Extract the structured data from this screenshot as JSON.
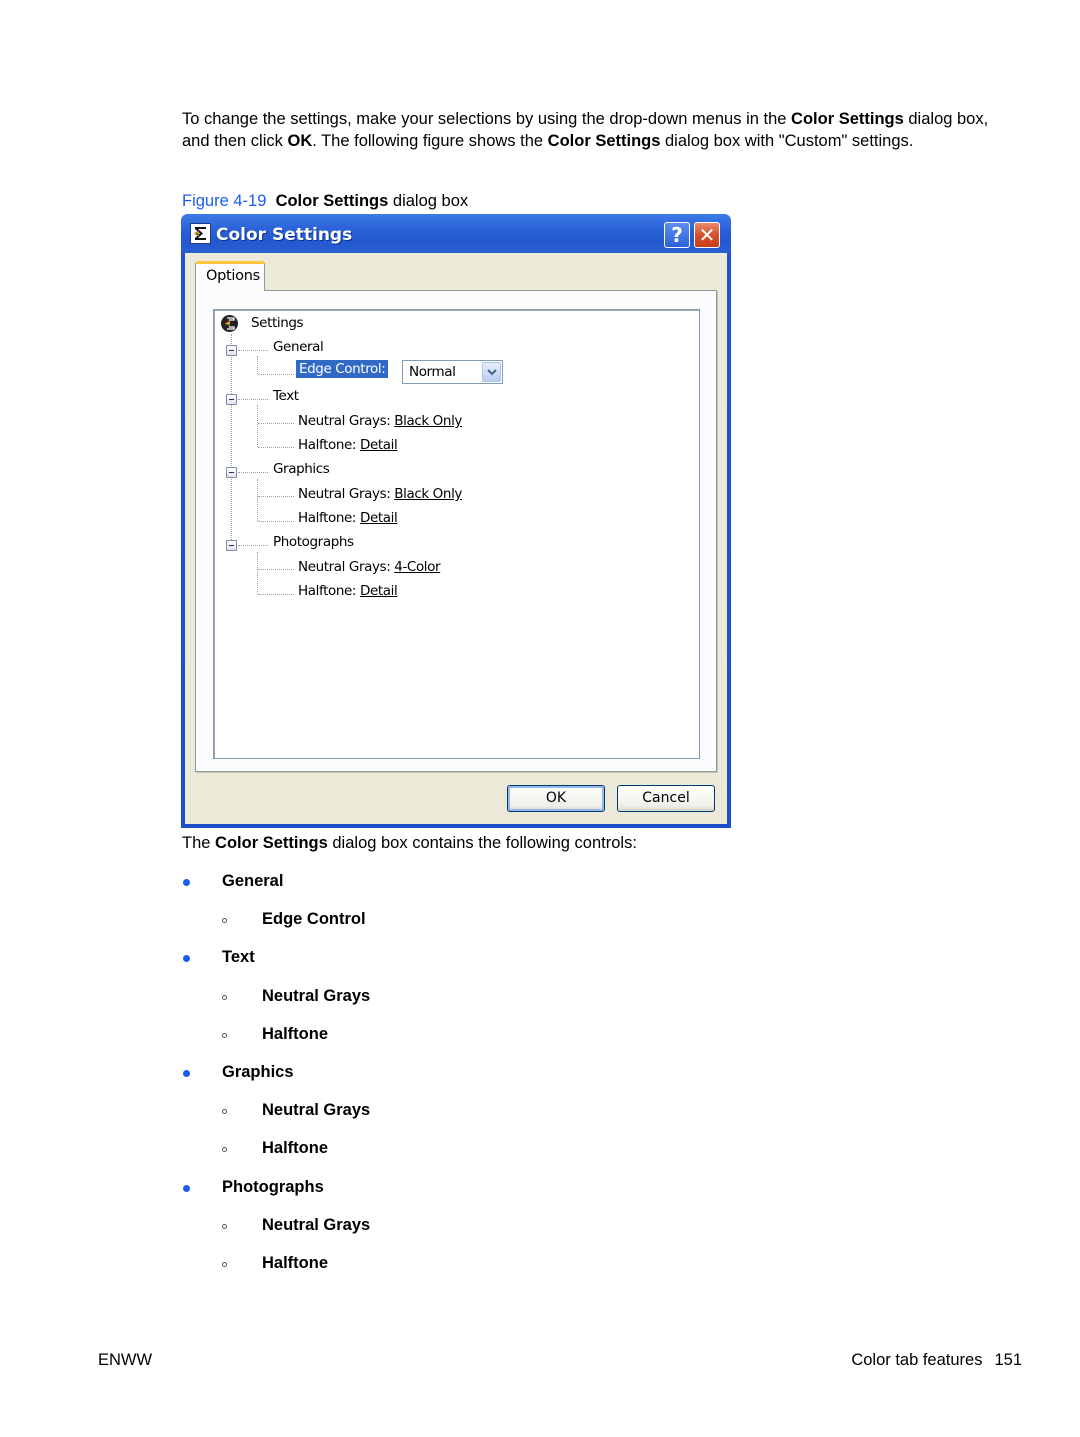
{
  "intro": {
    "part1": "To change the settings, make your selections by using the drop-down menus in the ",
    "bold1": "Color Settings",
    "part2": " dialog box, and then click ",
    "bold2": "OK",
    "part3": ". The following figure shows the ",
    "bold3": "Color Settings",
    "part4": " dialog box with \"Custom\" settings."
  },
  "caption": {
    "figure_label": "Figure 4-19",
    "bold_title": "Color Settings",
    "rest": " dialog box"
  },
  "dialog": {
    "title": "Color Settings",
    "help_label": "?",
    "close_label": "✕",
    "tab_label": "Options",
    "tree": {
      "root": "Settings",
      "general": {
        "label": "General",
        "edge_control_label": "Edge Control:",
        "edge_control_value": "Normal"
      },
      "text": {
        "label": "Text",
        "neutral_grays_label": "Neutral Grays: ",
        "neutral_grays_value": "Black Only",
        "halftone_label": "Halftone: ",
        "halftone_value": "Detail"
      },
      "graphics": {
        "label": "Graphics",
        "neutral_grays_label": "Neutral Grays: ",
        "neutral_grays_value": "Black Only",
        "halftone_label": "Halftone: ",
        "halftone_value": "Detail"
      },
      "photographs": {
        "label": "Photographs",
        "neutral_grays_label": "Neutral Grays: ",
        "neutral_grays_value": "4-Color",
        "halftone_label": "Halftone: ",
        "halftone_value": "Detail"
      }
    },
    "ok_label": "OK",
    "cancel_label": "Cancel"
  },
  "summary": {
    "part1": "The ",
    "bold": "Color Settings",
    "part2": " dialog box contains the following controls:"
  },
  "controls_list": [
    {
      "level": 1,
      "label": "General"
    },
    {
      "level": 2,
      "label": "Edge Control"
    },
    {
      "level": 1,
      "label": "Text"
    },
    {
      "level": 2,
      "label": "Neutral Grays"
    },
    {
      "level": 2,
      "label": "Halftone"
    },
    {
      "level": 1,
      "label": "Graphics"
    },
    {
      "level": 2,
      "label": "Neutral Grays"
    },
    {
      "level": 2,
      "label": "Halftone"
    },
    {
      "level": 1,
      "label": "Photographs"
    },
    {
      "level": 2,
      "label": "Neutral Grays"
    },
    {
      "level": 2,
      "label": "Halftone"
    }
  ],
  "footer": {
    "left": "ENWW",
    "section": "Color tab features",
    "page": "151"
  },
  "colors": {
    "accent_blue": "#1a5cf0",
    "titlebar_blue": "#2a62d8",
    "selection_blue": "#316ac5"
  }
}
